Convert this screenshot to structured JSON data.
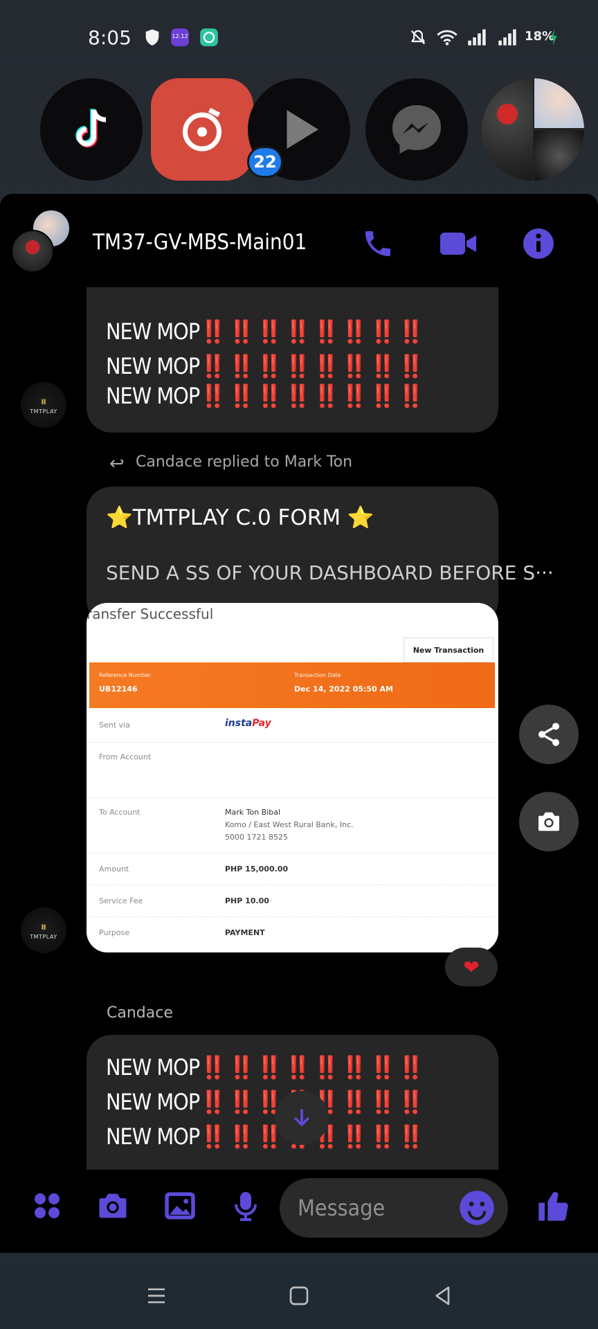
{
  "status_bar": {
    "time": "8:05",
    "battery": "18%",
    "icons": [
      "shield-icon",
      "calendar-app-icon",
      "assistant-icon",
      "mute-icon",
      "wifi-icon",
      "signal-icon",
      "signal-icon-2",
      "charging-icon"
    ]
  },
  "recent_apps": [
    {
      "name": "TikTok",
      "icon": "tiktok-icon",
      "label": "TikTok"
    },
    {
      "name": "Music",
      "icon": "music-icon",
      "label": "Music"
    },
    {
      "name": "Messenger Video",
      "icon": "play-icon",
      "label": "Messenger",
      "badge": "22"
    },
    {
      "name": "Facebook Messenger",
      "icon": "messenger-icon",
      "label": "Facebook"
    },
    {
      "name": "Contact",
      "icon": "contact-photo",
      "label": ""
    }
  ],
  "header": {
    "title": "TM37-GV-MBS-Main01",
    "actions": [
      "phone-icon",
      "video-call-icon",
      "info-icon"
    ],
    "accent": "#5b4bd8"
  },
  "messages": {
    "mop_lines_top": [
      "NEW MOP",
      "NEW MOP",
      "NEW MOP"
    ],
    "mop_marks": "‼️‼️‼️‼️‼️‼️‼️‼️",
    "reply_note": "Candace replied to Mark Ton",
    "form_title": "⭐TMTPLAY  C.0 FORM ⭐",
    "form_sub": "SEND A SS OF YOUR DASHBOARD BEFORE S···",
    "sender_avatar_text": "TMTPLAY",
    "reaction": "❤",
    "sender_name": "Candace",
    "mop_lines_bottom": [
      "NEW MOP",
      "NEW MOP",
      "NEW MOP"
    ]
  },
  "receipt": {
    "title": "ransfer Successful",
    "new_transaction": "New Transaction",
    "reference_label": "Reference Number",
    "reference_value": "UB12146",
    "date_label": "Transaction Date",
    "date_value": "Dec 14, 2022 05:50 AM",
    "rows": [
      {
        "label": "Sent via",
        "value": "instaPay"
      },
      {
        "label": "From Account",
        "value": ""
      },
      {
        "label": "To Account",
        "value": "Mark Ton Bibal",
        "value2": "Komo / East West Rural Bank, Inc.",
        "value3": "5000 1721 8525"
      },
      {
        "label": "Amount",
        "value": "PHP 15,000.00"
      },
      {
        "label": "Service Fee",
        "value": "PHP 10.00"
      },
      {
        "label": "Purpose",
        "value": "PAYMENT"
      }
    ]
  },
  "composer": {
    "placeholder": "Message",
    "buttons": [
      "apps-icon",
      "camera-icon",
      "gallery-icon",
      "mic-icon",
      "emoji-icon",
      "like-icon"
    ]
  },
  "side_actions": [
    "share-icon",
    "screenshot-icon"
  ],
  "nav": [
    "recents-icon",
    "home-icon",
    "back-icon"
  ]
}
